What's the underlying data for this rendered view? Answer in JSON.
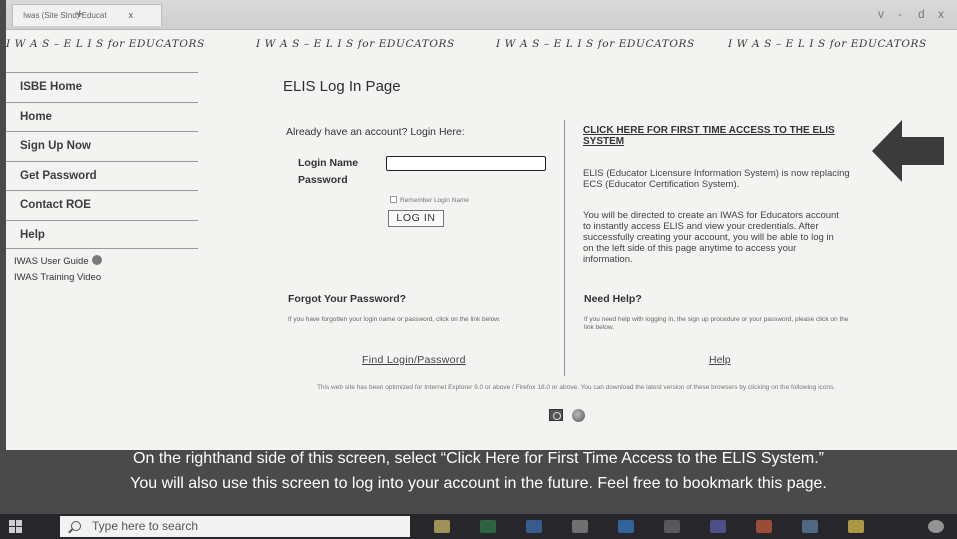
{
  "browser": {
    "tab_title": "Iwas (Site Stnd) Educat",
    "tab_close": "x",
    "new_tab": "+",
    "window_controls": [
      "v",
      "-",
      "d",
      "x"
    ]
  },
  "banner": {
    "text": "I W A S  –  E L I S  for EDUCATORS"
  },
  "sidebar": {
    "items": [
      {
        "label": "ISBE Home"
      },
      {
        "label": "Home"
      },
      {
        "label": "Sign Up Now"
      },
      {
        "label": "Get Password"
      },
      {
        "label": "Contact ROE"
      },
      {
        "label": "Help"
      }
    ],
    "links": [
      {
        "label": "IWAS User Guide"
      },
      {
        "label": "IWAS Training Video"
      }
    ]
  },
  "page": {
    "title": "ELIS Log In Page"
  },
  "login": {
    "heading": "Already have an account?  Login Here:",
    "login_name_label": "Login Name",
    "password_label": "Password",
    "login_name_value": "",
    "remember_label": "Remember Login Name",
    "button_label": "LOG IN"
  },
  "first_time": {
    "link": "CLICK HERE FOR FIRST TIME ACCESS TO THE ELIS SYSTEM",
    "elis_desc": "ELIS (Educator Licensure Information System) is now replacing ECS (Educator Certification System).",
    "directed": "You will be directed to create an IWAS for Educators account to instantly access ELIS and view your credentials. After successfully creating your account, you will be able to log in on the left side of this page anytime to access your information."
  },
  "forgot": {
    "heading": "Forgot Your Password?",
    "text": "If you have forgotten your login name or password, click on the link below.",
    "link": "Find Login/Password"
  },
  "need_help": {
    "heading": "Need Help?",
    "text": "If you need help with logging in, the sign up procedure or your password, please click on the link below.",
    "link": "Help"
  },
  "footer": {
    "optimized": "This web site has been optimized for Internet Explorer 9.0 or above / Firefox 18.0 or above. You can download the latest version of these browsers by clicking on the following icons."
  },
  "caption": {
    "line1": "On the righthand side of this screen, select “Click Here for First Time Access to the ELIS System.”",
    "line2": "You will also use this screen to log into your account in the future. Feel free to bookmark this page."
  },
  "taskbar": {
    "search_placeholder": "Type here to search",
    "apps": [
      "file-explorer-icon",
      "excel-icon",
      "word-icon",
      "browser-icon",
      "outlook-icon",
      "calculator-icon",
      "teams-icon",
      "powerpoint-icon",
      "photos-icon",
      "notes-icon",
      "chrome-icon"
    ]
  },
  "colors": {
    "page_bg": "#f3f3f1",
    "taskbar_bg": "#26262b",
    "caption_bg": "#4a4a4a",
    "arrow": "#3b3b3b"
  }
}
